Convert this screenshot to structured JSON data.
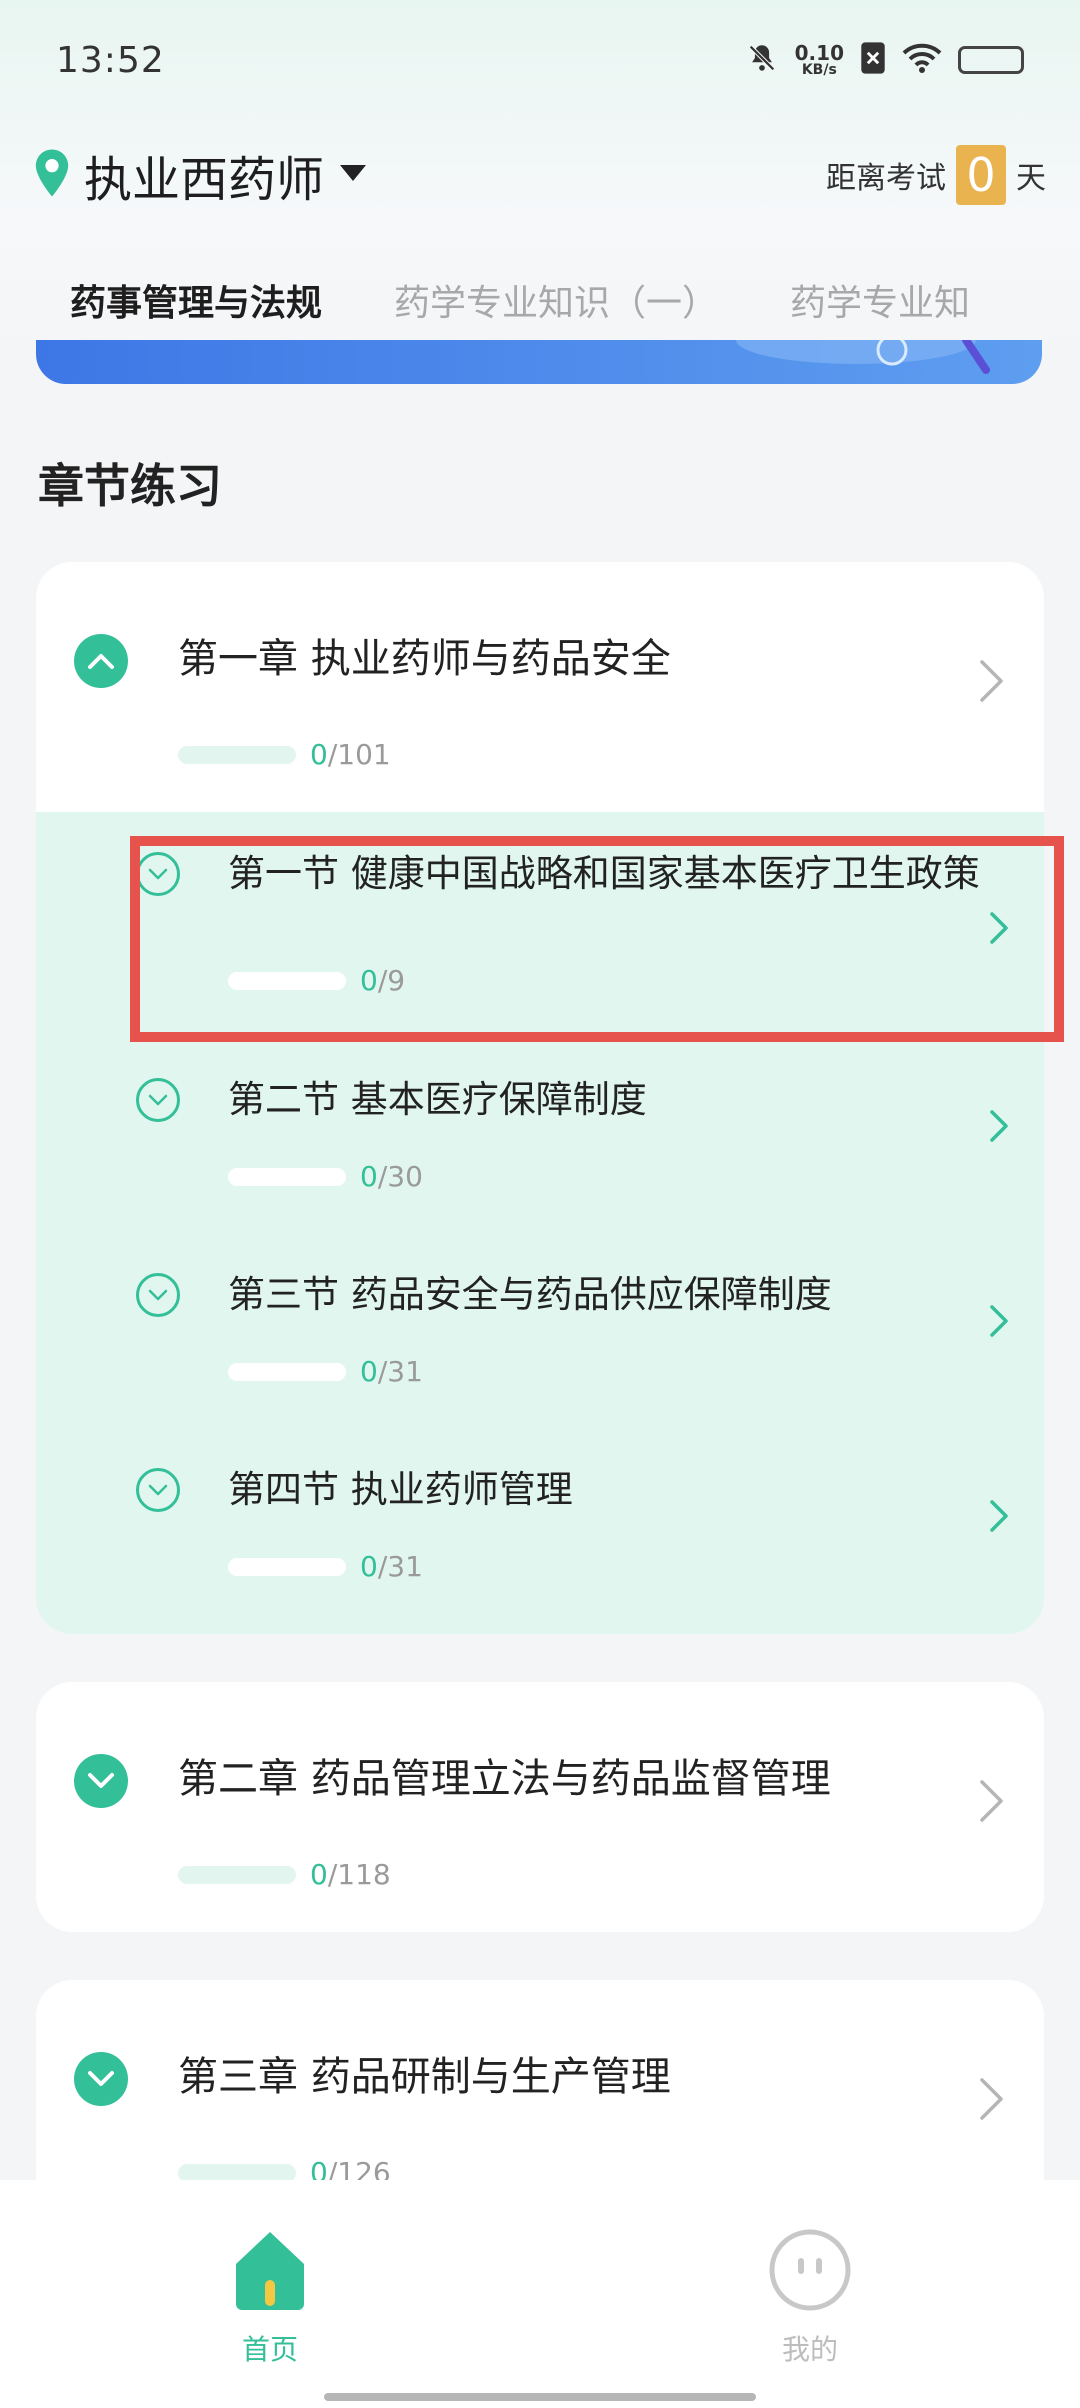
{
  "status_bar": {
    "time": "13:52",
    "net_speed_value": "0.10",
    "net_speed_unit": "KB/s"
  },
  "header": {
    "location_title": "执业西药师",
    "exam_label": "距离考试",
    "exam_count": "0",
    "exam_unit": "天"
  },
  "tabs": [
    {
      "label": "药事管理与法规"
    },
    {
      "label": "药学专业知识（一）"
    },
    {
      "label": "药学专业知"
    }
  ],
  "section_title": "章节练习",
  "chapters": [
    {
      "title": "第一章 执业药师与药品安全",
      "done": "0",
      "total": "/101",
      "sections": [
        {
          "title": "第一节 健康中国战略和国家基本医疗卫生政策",
          "done": "0",
          "total": "/9"
        },
        {
          "title": "第二节 基本医疗保障制度",
          "done": "0",
          "total": "/30"
        },
        {
          "title": "第三节 药品安全与药品供应保障制度",
          "done": "0",
          "total": "/31"
        },
        {
          "title": "第四节 执业药师管理",
          "done": "0",
          "total": "/31"
        }
      ]
    },
    {
      "title": "第二章 药品管理立法与药品监督管理",
      "done": "0",
      "total": "/118"
    },
    {
      "title": "第三章 药品研制与生产管理",
      "done": "0",
      "total": "/126"
    }
  ],
  "bottom_nav": {
    "home_label": "首页",
    "me_label": "我的"
  },
  "colors": {
    "accent": "#33bf98",
    "highlight": "#e6534d",
    "exam_box": "#e9b44f"
  }
}
